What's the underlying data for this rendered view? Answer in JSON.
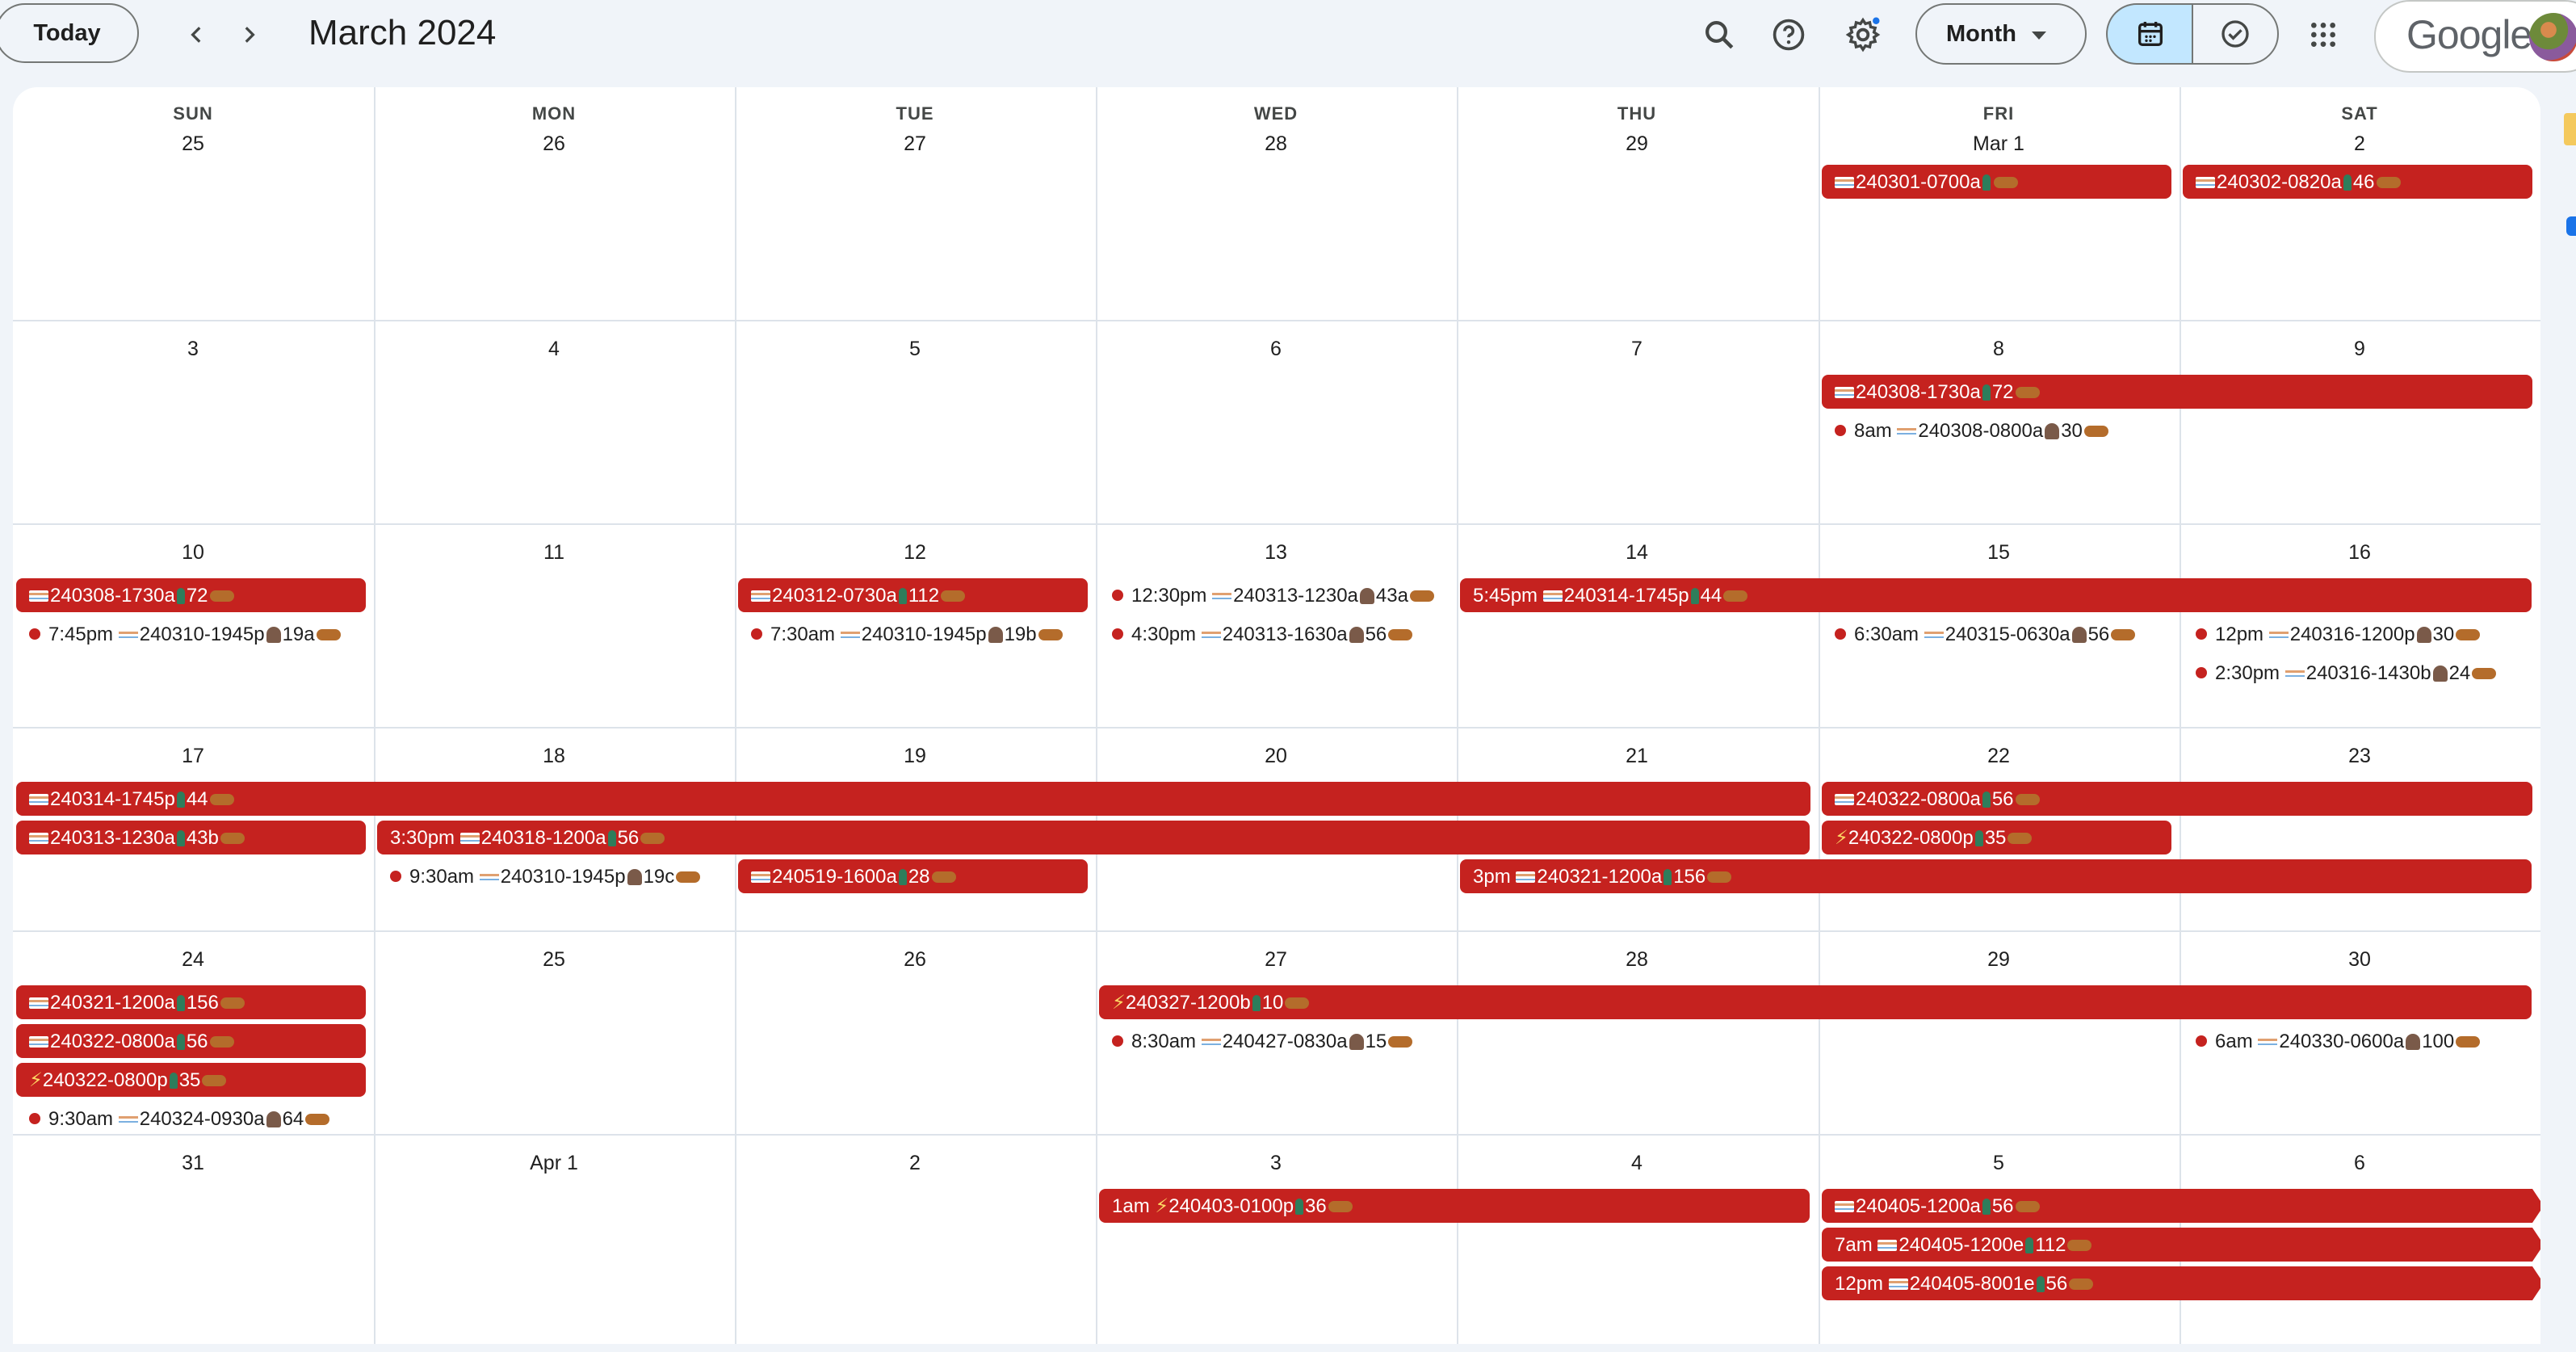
{
  "header": {
    "today_label": "Today",
    "month_title": "March 2024",
    "view_label": "Month",
    "brand": "Google"
  },
  "weekdays": [
    "SUN",
    "MON",
    "TUE",
    "WED",
    "THU",
    "FRI",
    "SAT"
  ],
  "weeks": [
    [
      "25",
      "26",
      "27",
      "28",
      "29",
      "Mar 1",
      "2"
    ],
    [
      "3",
      "4",
      "5",
      "6",
      "7",
      "8",
      "9"
    ],
    [
      "10",
      "11",
      "12",
      "13",
      "14",
      "15",
      "16"
    ],
    [
      "17",
      "18",
      "19",
      "20",
      "21",
      "22",
      "23"
    ],
    [
      "24",
      "25",
      "26",
      "27",
      "28",
      "29",
      "30"
    ],
    [
      "31",
      "Apr 1",
      "2",
      "3",
      "4",
      "5",
      "6"
    ]
  ],
  "events": [
    {
      "week": 0,
      "col": 5,
      "span": 1,
      "row": 0,
      "text": "240301-0700a",
      "type": "allday"
    },
    {
      "week": 0,
      "col": 6,
      "span": 1,
      "row": 0,
      "text": "240302-0820a",
      "suffix": "46",
      "type": "allday"
    },
    {
      "week": 1,
      "col": 5,
      "span": 2,
      "row": 0,
      "text": "240308-1730a",
      "suffix": "72",
      "type": "allday"
    },
    {
      "week": 1,
      "col": 5,
      "span": 1,
      "row": 1,
      "time": "8am",
      "text": "240308-0800a",
      "suffix": "30",
      "type": "timed"
    },
    {
      "week": 2,
      "col": 0,
      "span": 1,
      "row": 0,
      "text": "240308-1730a",
      "suffix": "72",
      "type": "allday"
    },
    {
      "week": 2,
      "col": 0,
      "span": 1,
      "row": 1,
      "time": "7:45pm",
      "text": "240310-1945p",
      "suffix": "19a",
      "type": "timed"
    },
    {
      "week": 2,
      "col": 2,
      "span": 1,
      "row": 0,
      "text": "240312-0730a",
      "suffix": "112",
      "type": "allday"
    },
    {
      "week": 2,
      "col": 2,
      "span": 1,
      "row": 1,
      "time": "7:30am",
      "text": "240310-1945p",
      "suffix": "19b",
      "type": "timed"
    },
    {
      "week": 2,
      "col": 3,
      "span": 1,
      "row": 0,
      "time": "12:30pm",
      "text": "240313-1230a",
      "suffix": "43a",
      "type": "timed"
    },
    {
      "week": 2,
      "col": 3,
      "span": 1,
      "row": 1,
      "time": "4:30pm",
      "text": "240313-1630a",
      "suffix": "56",
      "type": "timed"
    },
    {
      "week": 2,
      "col": 4,
      "span": 3,
      "row": 0,
      "time": "5:45pm",
      "text": "240314-1745p",
      "suffix": "44",
      "type": "allday"
    },
    {
      "week": 2,
      "col": 5,
      "span": 1,
      "row": 1,
      "time": "6:30am",
      "text": "240315-0630a",
      "suffix": "56",
      "type": "timed"
    },
    {
      "week": 2,
      "col": 6,
      "span": 1,
      "row": 1,
      "time": "12pm",
      "text": "240316-1200p",
      "suffix": "30",
      "type": "timed"
    },
    {
      "week": 2,
      "col": 6,
      "span": 1,
      "row": 2,
      "time": "2:30pm",
      "text": "240316-1430b",
      "suffix": "24",
      "type": "timed"
    },
    {
      "week": 3,
      "col": 0,
      "span": 5,
      "row": 0,
      "text": "240314-1745p",
      "suffix": "44",
      "type": "allday"
    },
    {
      "week": 3,
      "col": 5,
      "span": 2,
      "row": 0,
      "text": "240322-0800a",
      "suffix": "56",
      "type": "allday"
    },
    {
      "week": 3,
      "col": 0,
      "span": 1,
      "row": 1,
      "text": "240313-1230a",
      "suffix": "43b",
      "type": "allday"
    },
    {
      "week": 3,
      "col": 1,
      "span": 4,
      "row": 1,
      "time": "3:30pm",
      "text": "240318-1200a",
      "suffix": "56",
      "type": "allday"
    },
    {
      "week": 3,
      "col": 5,
      "span": 1,
      "row": 1,
      "bolt": true,
      "text": "240322-0800p",
      "suffix": "35",
      "type": "allday"
    },
    {
      "week": 3,
      "col": 1,
      "span": 1,
      "row": 2,
      "time": "9:30am",
      "text": "240310-1945p",
      "suffix": "19c",
      "type": "timed"
    },
    {
      "week": 3,
      "col": 2,
      "span": 1,
      "row": 2,
      "text": "240519-1600a",
      "suffix": "28",
      "type": "allday"
    },
    {
      "week": 3,
      "col": 4,
      "span": 3,
      "row": 2,
      "time": "3pm",
      "text": "240321-1200a",
      "suffix": "156",
      "type": "allday"
    },
    {
      "week": 4,
      "col": 0,
      "span": 1,
      "row": 0,
      "text": "240321-1200a",
      "suffix": "156",
      "type": "allday"
    },
    {
      "week": 4,
      "col": 0,
      "span": 1,
      "row": 1,
      "text": "240322-0800a",
      "suffix": "56",
      "type": "allday"
    },
    {
      "week": 4,
      "col": 0,
      "span": 1,
      "row": 2,
      "bolt": true,
      "text": "240322-0800p",
      "suffix": "35",
      "type": "allday"
    },
    {
      "week": 4,
      "col": 0,
      "span": 1,
      "row": 3,
      "time": "9:30am",
      "text": "240324-0930a",
      "suffix": "64",
      "type": "timed"
    },
    {
      "week": 4,
      "col": 3,
      "span": 4,
      "row": 0,
      "bolt": true,
      "text": "240327-1200b",
      "suffix": "10",
      "type": "allday"
    },
    {
      "week": 4,
      "col": 3,
      "span": 1,
      "row": 1,
      "time": "8:30am",
      "text": "240427-0830a",
      "suffix": "15",
      "type": "timed"
    },
    {
      "week": 4,
      "col": 6,
      "span": 1,
      "row": 1,
      "time": "6am",
      "text": "240330-0600a",
      "suffix": "100",
      "type": "timed"
    },
    {
      "week": 5,
      "col": 3,
      "span": 2,
      "row": 0,
      "time": "1am",
      "bolt": true,
      "text": "240403-0100p",
      "suffix": "36",
      "type": "allday"
    },
    {
      "week": 5,
      "col": 5,
      "span": 2,
      "row": 0,
      "text": "240405-1200a",
      "suffix": "56",
      "type": "allday",
      "cont": true
    },
    {
      "week": 5,
      "col": 5,
      "span": 2,
      "row": 1,
      "time": "7am",
      "text": "240405-1200e",
      "suffix": "112",
      "type": "allday",
      "cont": true
    },
    {
      "week": 5,
      "col": 5,
      "span": 2,
      "row": 2,
      "time": "12pm",
      "text": "240405-8001e",
      "suffix": "56",
      "type": "allday",
      "cont": true
    }
  ],
  "colors": {
    "event": "#c5221f",
    "selected_view": "#c2e7ff",
    "page_bg": "#f0f4f9"
  },
  "icons": [
    "search-icon",
    "help-icon",
    "settings-icon",
    "calendar-icon",
    "tasks-icon",
    "apps-grid-icon"
  ]
}
